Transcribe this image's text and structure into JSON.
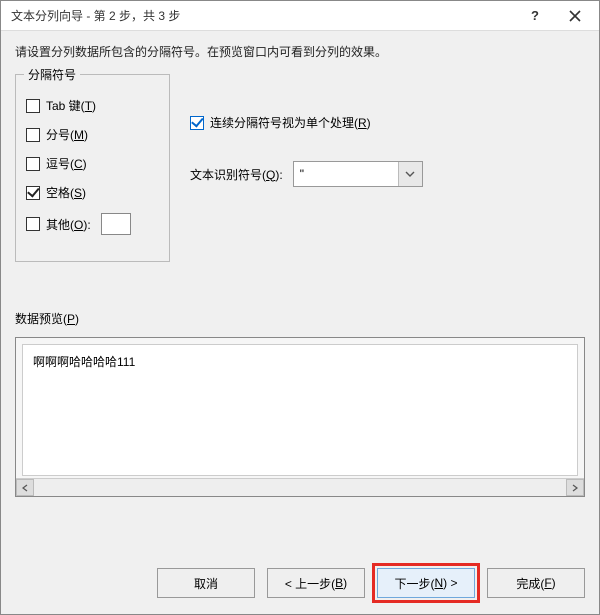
{
  "titlebar": {
    "title": "文本分列向导 - 第 2 步，共 3 步"
  },
  "instruction": "请设置分列数据所包含的分隔符号。在预览窗口内可看到分列的效果。",
  "delimiters": {
    "legend": "分隔符号",
    "tab": {
      "label_pre": "Tab 键(",
      "hotkey": "T",
      "label_post": ")",
      "checked": false
    },
    "semi": {
      "label_pre": "分号(",
      "hotkey": "M",
      "label_post": ")",
      "checked": false
    },
    "comma": {
      "label_pre": "逗号(",
      "hotkey": "C",
      "label_post": ")",
      "checked": false
    },
    "space": {
      "label_pre": "空格(",
      "hotkey": "S",
      "label_post": ")",
      "checked": true
    },
    "other": {
      "label_pre": "其他(",
      "hotkey": "O",
      "label_post": "):",
      "checked": false,
      "value": ""
    }
  },
  "treat_consecutive": {
    "label_pre": "连续分隔符号视为单个处理(",
    "hotkey": "R",
    "label_post": ")",
    "checked": true
  },
  "text_qualifier": {
    "label_pre": "文本识别符号(",
    "hotkey": "Q",
    "label_post": "):",
    "value": "\""
  },
  "preview": {
    "label_pre": "数据预览(",
    "hotkey": "P",
    "label_post": ")",
    "sample": "啊啊啊哈哈哈哈111"
  },
  "buttons": {
    "cancel": "取消",
    "back": {
      "pre": "< 上一步(",
      "hotkey": "B",
      "post": ")"
    },
    "next": {
      "pre": "下一步(",
      "hotkey": "N",
      "post": ") >"
    },
    "finish": {
      "pre": "完成(",
      "hotkey": "F",
      "post": ")"
    }
  },
  "icons": {
    "help": "?",
    "close": "x",
    "chevron_down": "v"
  }
}
